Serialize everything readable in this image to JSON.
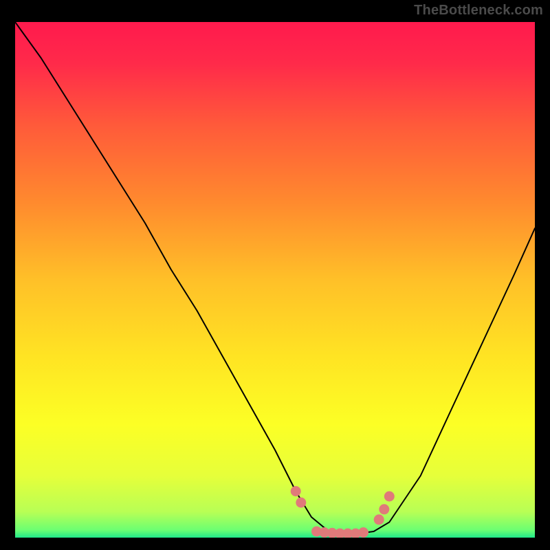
{
  "watermark": "TheBottleneck.com",
  "chart_data": {
    "type": "line",
    "title": "",
    "xlabel": "",
    "ylabel": "",
    "xlim": [
      0,
      100
    ],
    "ylim": [
      0,
      100
    ],
    "legend": false,
    "grid": false,
    "background_gradient_anchor": "bottleneck-percent",
    "series": [
      {
        "name": "bottleneck-curve",
        "x": [
          0,
          5,
          10,
          15,
          20,
          25,
          30,
          35,
          40,
          45,
          50,
          54,
          57,
          60,
          63,
          66,
          69,
          72,
          78,
          84,
          90,
          96,
          100
        ],
        "y": [
          100,
          93,
          85,
          77,
          69,
          61,
          52,
          44,
          35,
          26,
          17,
          9,
          4,
          1.5,
          0.8,
          0.8,
          1.2,
          3,
          12,
          25,
          38,
          51,
          60
        ]
      }
    ],
    "markers": {
      "name": "optimal-range-dots",
      "color": "#e07a7a",
      "points": [
        {
          "x": 54.0,
          "y": 9.0
        },
        {
          "x": 55.0,
          "y": 6.8
        },
        {
          "x": 58.0,
          "y": 1.2
        },
        {
          "x": 59.5,
          "y": 1.0
        },
        {
          "x": 61.0,
          "y": 0.9
        },
        {
          "x": 62.5,
          "y": 0.8
        },
        {
          "x": 64.0,
          "y": 0.8
        },
        {
          "x": 65.5,
          "y": 0.8
        },
        {
          "x": 67.0,
          "y": 1.0
        },
        {
          "x": 70.0,
          "y": 3.5
        },
        {
          "x": 71.0,
          "y": 5.5
        },
        {
          "x": 72.0,
          "y": 8.0
        }
      ]
    }
  }
}
